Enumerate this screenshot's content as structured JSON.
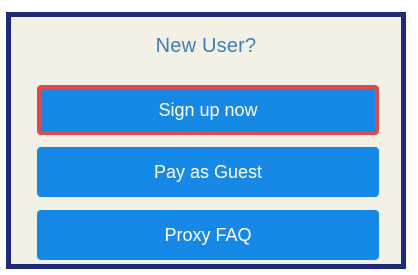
{
  "dialog": {
    "title": "New User?",
    "buttons": {
      "signup": "Sign up now",
      "guest": "Pay as Guest",
      "faq": "Proxy FAQ"
    }
  },
  "colors": {
    "frame_border": "#1d2a7a",
    "panel_bg": "#f3f0e6",
    "title_text": "#3f7fb6",
    "button_bg": "#1689e6",
    "highlight_border": "#e14a4a"
  }
}
